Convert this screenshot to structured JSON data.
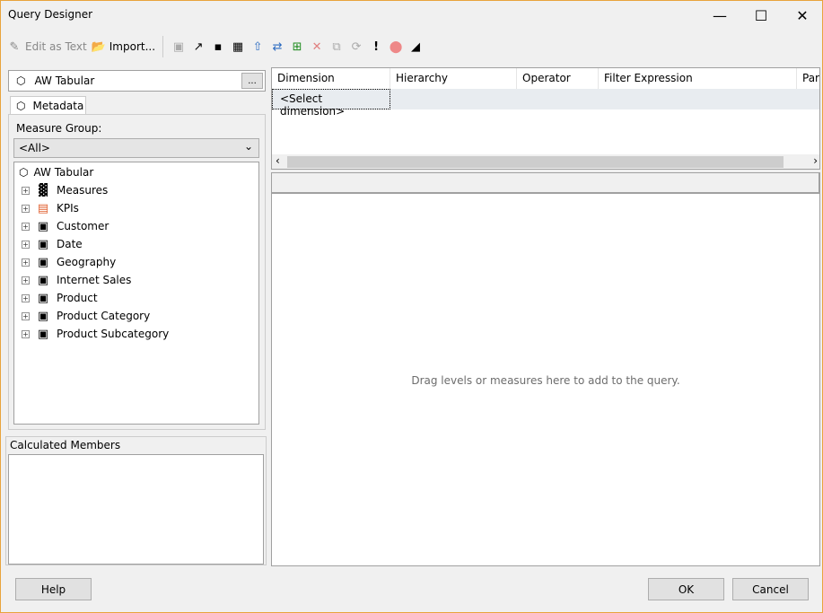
{
  "window": {
    "title": "Query Designer"
  },
  "toolbar": {
    "edit_as_text": "Edit as Text",
    "import": "Import...",
    "icons": [
      "add-calculated-member-icon",
      "pickaxe-icon",
      "show-empty-cells-icon",
      "calculator-icon",
      "auto-execute-icon",
      "show-aggregations-icon",
      "add-row-icon",
      "delete-icon",
      "copy-icon",
      "refresh-icon",
      "execute-icon",
      "cancel-query-icon",
      "design-mode-icon"
    ]
  },
  "left": {
    "cube_name": "AW Tabular",
    "browse_button": "...",
    "tab": "Metadata",
    "measure_group_label": "Measure Group:",
    "measure_group_value": "<All>",
    "tree_root": "AW Tabular",
    "tree_items": [
      {
        "label": "Measures",
        "icon": "measures-icon"
      },
      {
        "label": "KPIs",
        "icon": "kpis-icon"
      },
      {
        "label": "Customer",
        "icon": "dimension-icon"
      },
      {
        "label": "Date",
        "icon": "dimension-icon"
      },
      {
        "label": "Geography",
        "icon": "dimension-icon"
      },
      {
        "label": "Internet Sales",
        "icon": "dimension-icon"
      },
      {
        "label": "Product",
        "icon": "dimension-icon"
      },
      {
        "label": "Product Category",
        "icon": "dimension-icon"
      },
      {
        "label": "Product Subcategory",
        "icon": "dimension-icon"
      }
    ],
    "calculated_members": "Calculated Members"
  },
  "filter": {
    "columns": [
      "Dimension",
      "Hierarchy",
      "Operator",
      "Filter Expression",
      "Par"
    ],
    "row": "<Select dimension>"
  },
  "results": {
    "placeholder": "Drag levels or measures here to add to the query."
  },
  "footer": {
    "help": "Help",
    "ok": "OK",
    "cancel": "Cancel"
  }
}
